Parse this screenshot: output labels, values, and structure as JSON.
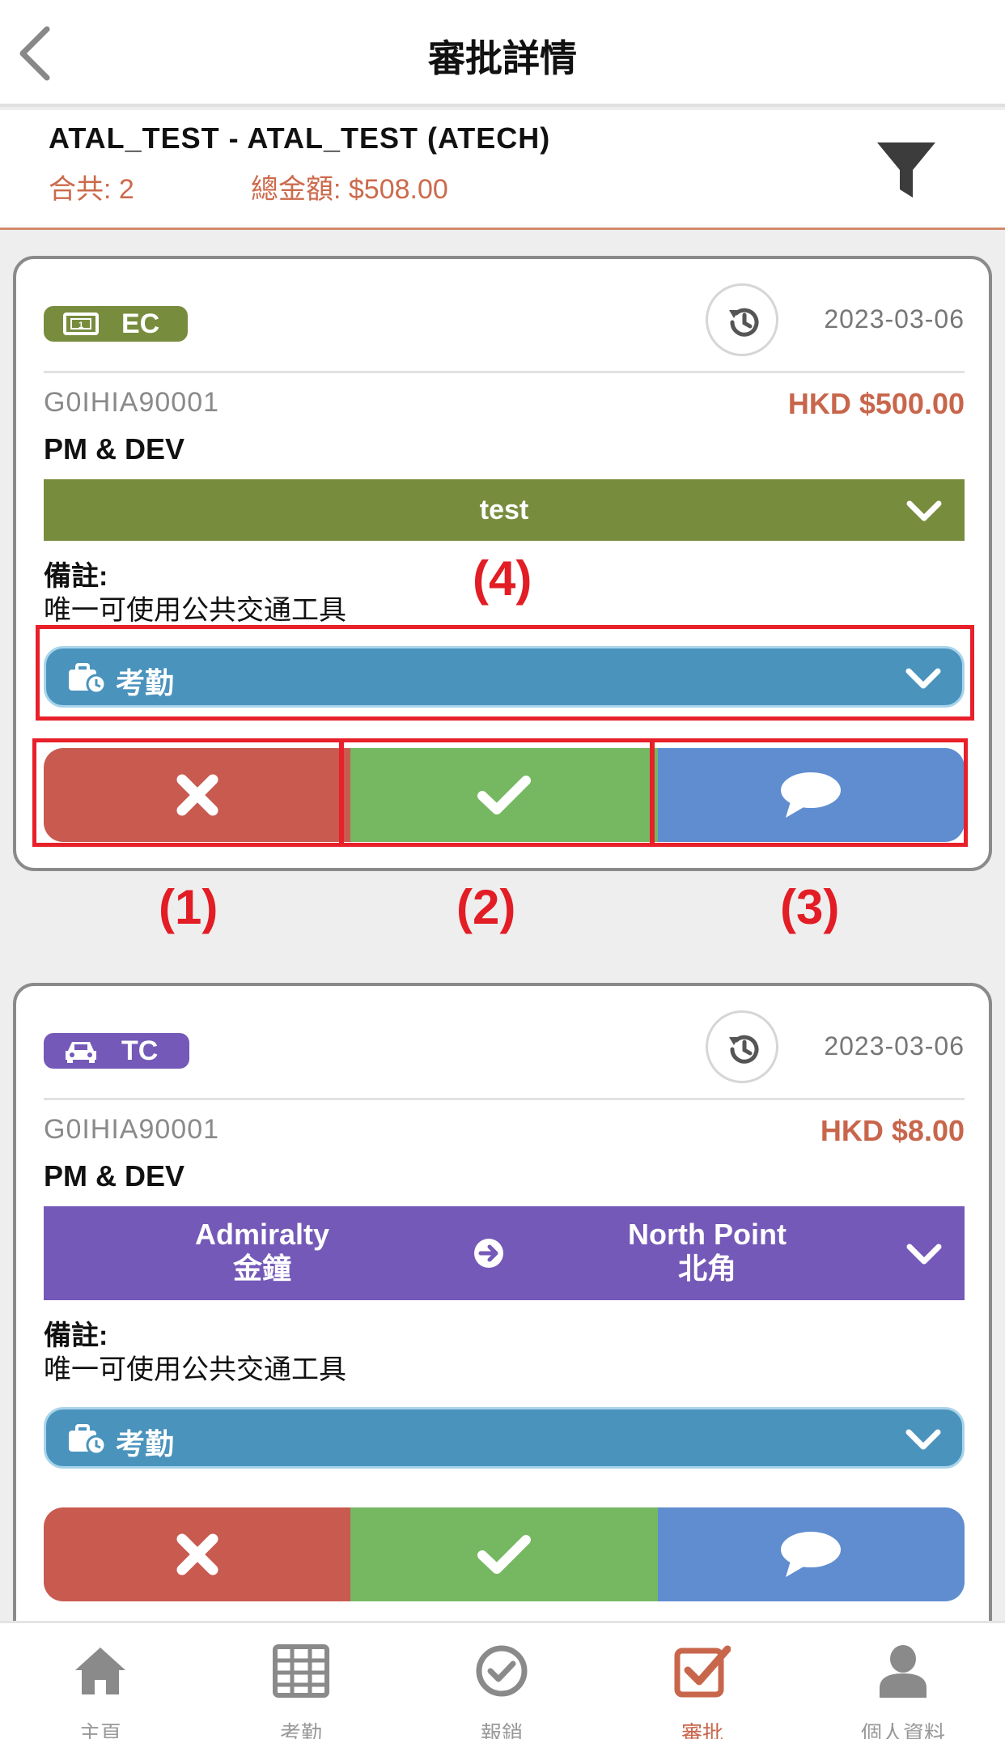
{
  "navbar": {
    "title": "審批詳情"
  },
  "summary": {
    "account": "ATAL_TEST - ATAL_TEST (ATECH)",
    "count_text": "合共: 2",
    "total_text": "總金額: $508.00"
  },
  "cards": [
    {
      "type": "EC",
      "type_icon": "banknote-icon",
      "badge_color": "#788c3e",
      "date": "2023-03-06",
      "ref_no": "G0IHIA90001",
      "amount": "HKD $500.00",
      "dept": "PM & DEV",
      "description": "test",
      "remark_label": "備註:",
      "remark": "唯一可使用公共交通工具",
      "category": "考勤"
    },
    {
      "type": "TC",
      "type_icon": "car-icon",
      "badge_color": "#7459b8",
      "date": "2023-03-06",
      "ref_no": "G0IHIA90001",
      "amount": "HKD $8.00",
      "dept": "PM & DEV",
      "route": {
        "from_en": "Admiralty",
        "from_zh": "金鐘",
        "to_en": "North Point",
        "to_zh": "北角"
      },
      "remark_label": "備註:",
      "remark": "唯一可使用公共交通工具",
      "category": "考勤"
    }
  ],
  "annotations": {
    "reject": "(1)",
    "approve": "(2)",
    "comment": "(3)",
    "category": "(4)"
  },
  "tabbar": {
    "items": [
      {
        "label": "主頁",
        "icon": "home-icon"
      },
      {
        "label": "考勤",
        "icon": "calendar-grid-icon"
      },
      {
        "label": "報銷",
        "icon": "check-circle-icon"
      },
      {
        "label": "審批",
        "icon": "approve-check-icon",
        "active": true
      },
      {
        "label": "個人資料",
        "icon": "person-icon"
      }
    ],
    "active_color": "#c8664c"
  }
}
